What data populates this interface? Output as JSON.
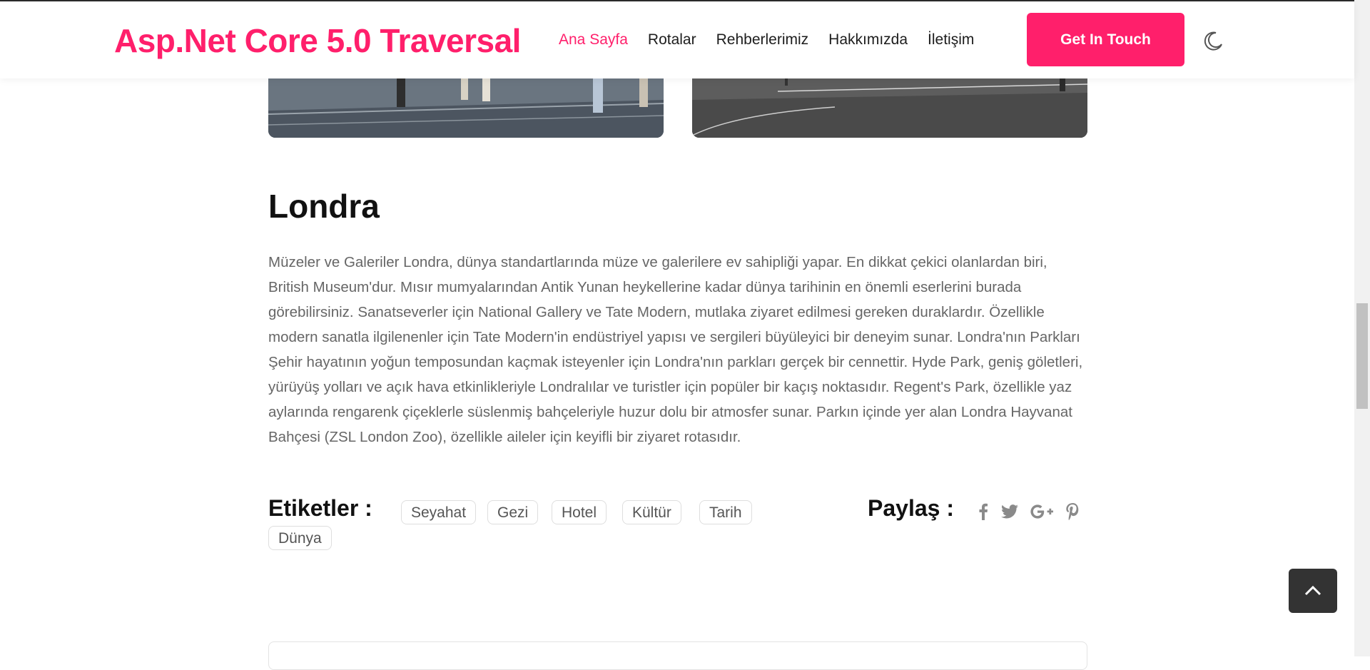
{
  "header": {
    "brand": "Asp.Net Core 5.0 Traversal",
    "nav": [
      {
        "label": "Ana Sayfa",
        "active": true
      },
      {
        "label": "Rotalar"
      },
      {
        "label": "Rehberlerimiz"
      },
      {
        "label": "Hakkımızda"
      },
      {
        "label": "İletişim"
      }
    ],
    "cta_label": "Get In Touch",
    "theme_icon": "moon-icon"
  },
  "article": {
    "title": "Londra",
    "body": "Müzeler ve Galeriler Londra, dünya standartlarında müze ve galerilere ev sahipliği yapar. En dikkat çekici olanlardan biri, British Museum'dur. Mısır mumyalarından Antik Yunan heykellerine kadar dünya tarihinin en önemli eserlerini burada görebilirsiniz. Sanatseverler için National Gallery ve Tate Modern, mutlaka ziyaret edilmesi gereken duraklardır. Özellikle modern sanatla ilgilenenler için Tate Modern'in endüstriyel yapısı ve sergileri büyüleyici bir deneyim sunar. Londra'nın Parkları Şehir hayatının yoğun temposundan kaçmak isteyenler için Londra'nın parkları gerçek bir cennettir. Hyde Park, geniş göletleri, yürüyüş yolları ve açık hava etkinlikleriyle Londralılar ve turistler için popüler bir kaçış noktasıdır. Regent's Park, özellikle yaz aylarında rengarenk çiçeklerle süslenmiş bahçeleriyle huzur dolu bir atmosfer sunar. Parkın içinde yer alan Londra Hayvanat Bahçesi (ZSL London Zoo), özellikle aileler için keyifli bir ziyaret rotasıdır."
  },
  "tags": {
    "label": "Etiketler :",
    "items": [
      "Seyahat",
      "Gezi",
      "Hotel",
      "Kültür",
      "Tarih",
      "Dünya"
    ]
  },
  "share": {
    "label": "Paylaş :",
    "icons": [
      "facebook-icon",
      "twitter-icon",
      "google-plus-icon",
      "pinterest-icon"
    ]
  },
  "colors": {
    "brand": "#ff1f6b",
    "text_dark": "#111111",
    "text_muted": "#666666",
    "back_to_top_bg": "#333333"
  }
}
